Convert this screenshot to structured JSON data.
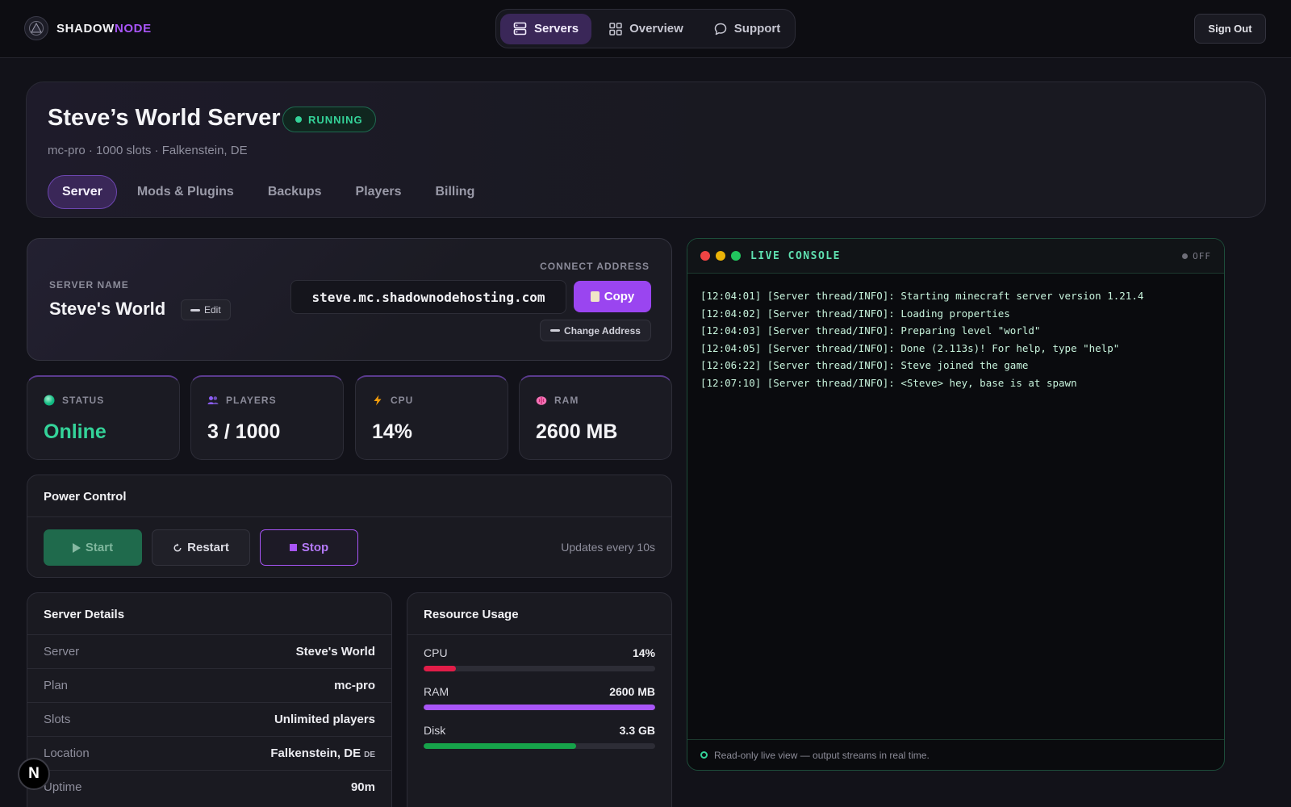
{
  "brand": {
    "part1": "SHADOW",
    "part2": "NODE"
  },
  "nav": {
    "items": [
      {
        "label": "Servers",
        "icon": "server-icon",
        "active": true
      },
      {
        "label": "Overview",
        "icon": "grid-icon",
        "active": false
      },
      {
        "label": "Support",
        "icon": "chat-bubble-icon",
        "active": false
      }
    ],
    "sign_out": "Sign Out"
  },
  "header": {
    "title": "Steve’s World Server",
    "status_badge": "RUNNING",
    "subtitle": "mc-pro · 1000 slots · Falkenstein, DE",
    "tabs": [
      "Server",
      "Mods & Plugins",
      "Backups",
      "Players",
      "Billing"
    ],
    "active_tab": "Server"
  },
  "server_name": {
    "label": "SERVER NAME",
    "value": "Steve's World",
    "edit_label": "Edit",
    "connect_label": "CONNECT ADDRESS",
    "address": "steve.mc.shadownodehosting.com",
    "copy_label": "Copy",
    "change_label": "Change Address"
  },
  "stats": [
    {
      "label": "STATUS",
      "value": "Online",
      "icon": "status-dot-icon"
    },
    {
      "label": "PLAYERS",
      "value": "3 / 1000",
      "icon": "users-icon"
    },
    {
      "label": "CPU",
      "value": "14%",
      "icon": "lightning-icon"
    },
    {
      "label": "RAM",
      "value": "2600 MB",
      "icon": "brain-icon"
    }
  ],
  "power": {
    "title": "Power Control",
    "start": "Start",
    "restart": "Restart",
    "stop": "Stop",
    "updates": "Updates every 10s"
  },
  "details": {
    "title": "Server Details",
    "rows": [
      {
        "key": "Server",
        "value": "Steve's World"
      },
      {
        "key": "Plan",
        "value": "mc-pro"
      },
      {
        "key": "Slots",
        "value": "Unlimited players"
      },
      {
        "key": "Location",
        "value": "Falkenstein, DE",
        "suffix": "DE"
      },
      {
        "key": "Uptime",
        "value": "90m"
      }
    ]
  },
  "resources": {
    "title": "Resource Usage",
    "items": [
      {
        "name": "CPU",
        "value": "14%",
        "fill_percent": 14,
        "color": "#e11d48"
      },
      {
        "name": "RAM",
        "value": "2600 MB",
        "fill_percent": 100,
        "color": "#a855f7"
      },
      {
        "name": "Disk",
        "value": "3.3 GB",
        "fill_percent": 66,
        "color": "#16a34a"
      }
    ]
  },
  "console": {
    "title": "LIVE CONSOLE",
    "state": "OFF",
    "lines": [
      "[12:04:01] [Server thread/INFO]: Starting minecraft server version 1.21.4",
      "[12:04:02] [Server thread/INFO]: Loading properties",
      "[12:04:03] [Server thread/INFO]: Preparing level \"world\"",
      "[12:04:05] [Server thread/INFO]: Done (2.113s)! For help, type \"help\"",
      "[12:06:22] [Server thread/INFO]: Steve joined the game",
      "[12:07:10] [Server thread/INFO]: <Steve> hey, base is at spawn"
    ],
    "footer": "Read-only live view — output streams in real time."
  },
  "floating": {
    "label": "N"
  },
  "colors": {
    "accent": "#a855f7",
    "success": "#34d399",
    "background": "#121219"
  }
}
